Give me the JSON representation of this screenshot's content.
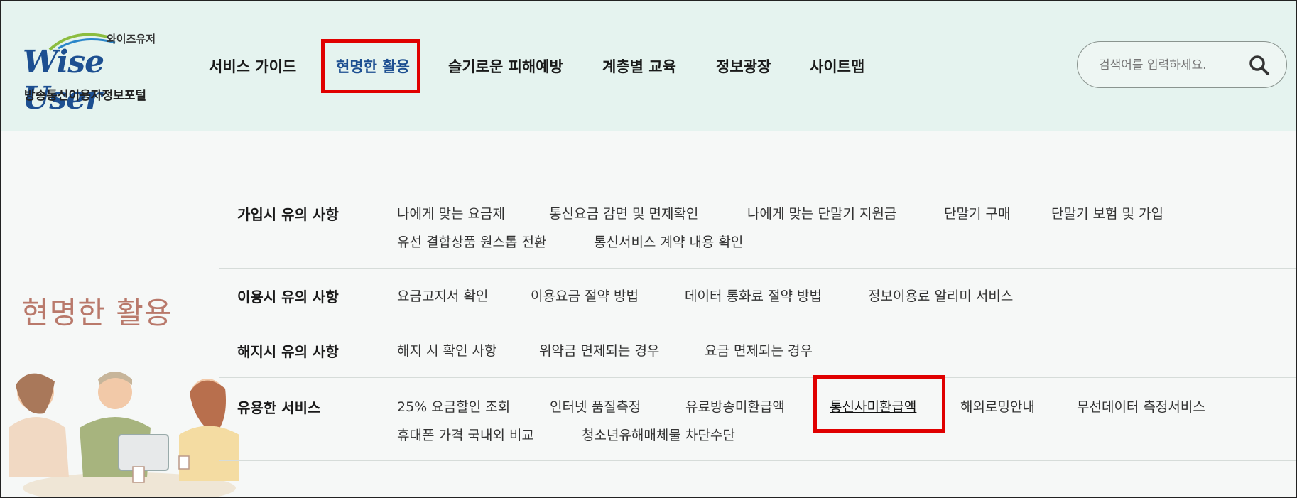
{
  "logo": {
    "small_text": "와이즈유저",
    "main_text": "Wise User",
    "subtitle": "방송통신이용자정보포털"
  },
  "nav": {
    "items": [
      "서비스 가이드",
      "현명한 활용",
      "슬기로운 피해예방",
      "계층별 교육",
      "정보광장",
      "사이트맵"
    ],
    "active_index": 1
  },
  "search": {
    "placeholder": "검색어를 입력하세요.",
    "icon": "search-icon"
  },
  "side_title": "현명한 활용",
  "menu": {
    "sections": [
      {
        "title": "가입시 유의 사항",
        "links": [
          "나에게 맞는 요금제",
          "통신요금 감면 및 면제확인",
          "나에게 맞는 단말기 지원금",
          "단말기 구매",
          "단말기 보험 및 가입",
          "유선 결합상품 원스톱 전환",
          "통신서비스 계약 내용 확인"
        ]
      },
      {
        "title": "이용시 유의 사항",
        "links": [
          "요금고지서 확인",
          "이용요금 절약 방법",
          "데이터 통화료 절약 방법",
          "정보이용료 알리미 서비스"
        ]
      },
      {
        "title": "해지시 유의 사항",
        "links": [
          "해지 시 확인 사항",
          "위약금 면제되는 경우",
          "요금 면제되는 경우"
        ]
      },
      {
        "title": "유용한 서비스",
        "links": [
          "25% 요금할인 조회",
          "인터넷 품질측정",
          "유료방송미환급액",
          "통신사미환급액",
          "해외로밍안내",
          "무선데이터 측정서비스",
          "휴대폰 가격 국내외 비교",
          "청소년유해매체물 차단수단"
        ]
      }
    ]
  },
  "colors": {
    "header_bg": "#e5f3ef",
    "brand_blue": "#1d4f91",
    "highlight_red": "#e00000",
    "side_title": "#b9796b"
  }
}
